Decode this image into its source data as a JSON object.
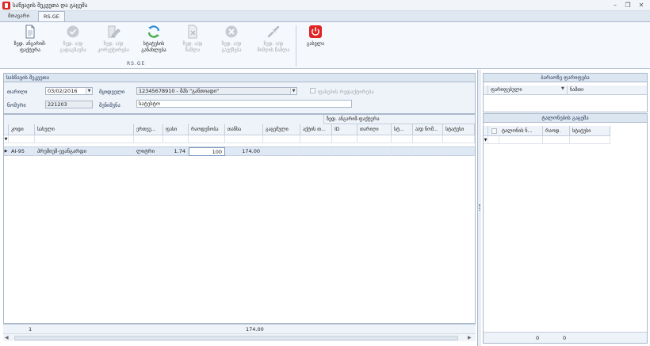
{
  "window": {
    "title": "საწვავის შეკვეთა და გაცემა"
  },
  "tabs": [
    {
      "label": "მთავარი"
    },
    {
      "label": "RS.GE"
    }
  ],
  "ribbon": {
    "buttons": [
      {
        "label": "ზედ. ანგარიშ-ფაქტურა",
        "icon": "document-icon",
        "enabled": true
      },
      {
        "label": "ზედ. ა/დ გადაგზავნა",
        "icon": "check-circle-icon",
        "enabled": false
      },
      {
        "label": "ზედ. ა/დ კორექტირება",
        "icon": "edit-icon",
        "enabled": false
      },
      {
        "label": "სტატუსის განახლება",
        "icon": "refresh-icon",
        "enabled": true
      },
      {
        "label": "ზედ. ა/დ წაშლა",
        "icon": "delete-document-icon",
        "enabled": false
      },
      {
        "label": "ზედ. ა/დ გაუქმება",
        "icon": "cancel-icon",
        "enabled": false
      },
      {
        "label": "ზედ. ა/დ მიმღის წაშლა",
        "icon": "unlink-icon",
        "enabled": false
      },
      {
        "label": "გასვლა",
        "icon": "power-icon",
        "enabled": true
      }
    ],
    "group_label": "RS.GE"
  },
  "waybill": {
    "header": "სასწავის შეკვეთა",
    "date_label": "თარიღი",
    "date_value": "03/02/2016",
    "buyer_label": "მყიდველი",
    "buyer_value": "12345678910 - შპს \"განთიადი\"",
    "edit_label": "ფასების რედაქტირება",
    "number_label": "ნომერი",
    "number_value": "221203",
    "note_label": "შენიშვნა",
    "note_value": "სატესტო"
  },
  "grid": {
    "band_label": "ზედ. ანგარიშ-ფაქტურა",
    "columns": [
      "კოდი",
      "სახელი",
      "ერთეუ...",
      "ფასი",
      "რაოდენობა",
      "თანხა",
      "გაცემული",
      "აქტის თ...",
      "ID",
      "თარიღი",
      "სტ...",
      "ა/დ ნომ...",
      "სტატუსი"
    ],
    "rows": [
      {
        "code": "AI-95",
        "name": "პრემიუმ-ევანგარდი",
        "unit": "ლიტრი",
        "price": "1.74",
        "qty": "100",
        "amount": "174.00"
      }
    ],
    "footer": {
      "count": "1",
      "total": "174.00"
    }
  },
  "prices_panel": {
    "header": "ბარაოზე ფარიფება",
    "columns": [
      "ფარიფებული",
      "ნაშთი"
    ]
  },
  "coupons_panel": {
    "header": "ტალონების გაცემა",
    "columns": [
      "ტალონის ნ...",
      "რაოდ.",
      "სტატუსი"
    ],
    "footer": {
      "left": "0",
      "right": "0"
    }
  },
  "colors": {
    "accent": "#e02424",
    "header_bg": "#dce6f1",
    "selected_row": "#dfe9f5"
  }
}
